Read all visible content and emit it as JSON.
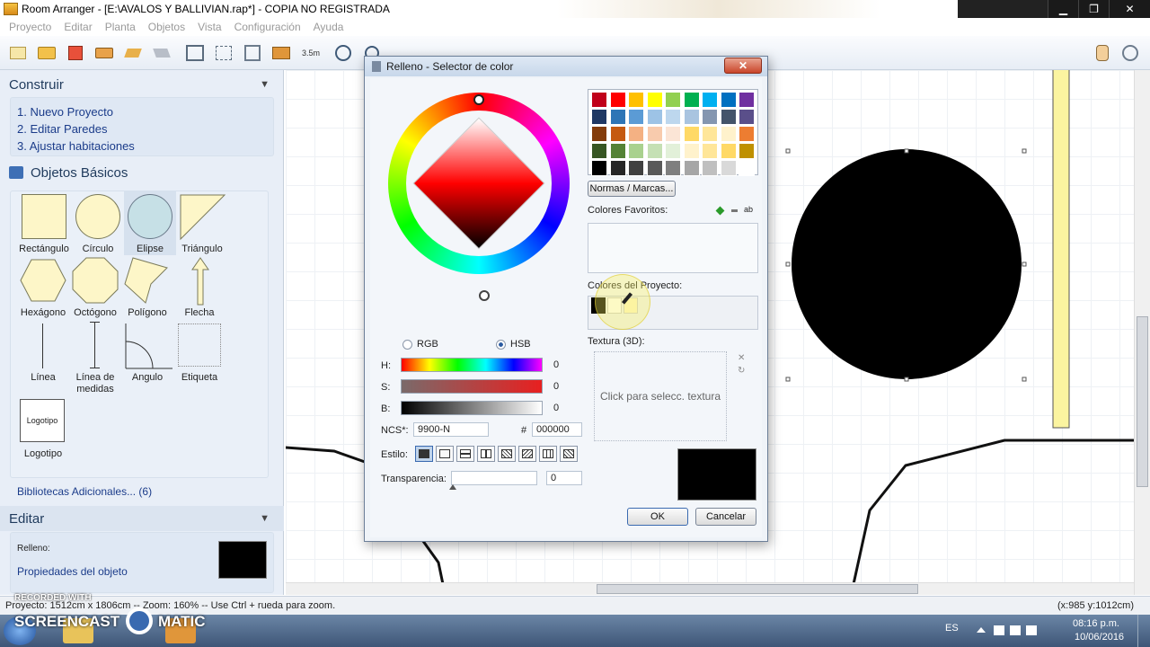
{
  "window": {
    "title": "Room Arranger - [E:\\AVALOS Y BALLIVIAN.rap*] - COPIA NO REGISTRADA",
    "minimize": "▁",
    "maximize": "❐",
    "close": "✕"
  },
  "menu": [
    "Proyecto",
    "Editar",
    "Planta",
    "Objetos",
    "Vista",
    "Configuración",
    "Ayuda"
  ],
  "toolbar": {
    "scale_label": "3.5m"
  },
  "construir": {
    "header": "Construir",
    "steps": [
      "1. Nuevo Proyecto",
      "2. Editar Paredes",
      "3. Ajustar habitaciones"
    ]
  },
  "objetos_basicos": {
    "header": "Objetos Básicos",
    "shapes": [
      "Rectángulo",
      "Círculo",
      "Elipse",
      "Triángulo",
      "Hexágono",
      "Octógono",
      "Polígono",
      "Flecha",
      "Línea",
      "Línea de medidas",
      "Angulo",
      "Etiqueta",
      "Logotipo"
    ],
    "logotipo_preview": "Logotipo",
    "bibliotecas": "Bibliotecas Adicionales... (6)"
  },
  "editar": {
    "header": "Editar",
    "relleno_label": "Relleno:",
    "propiedades": "Propiedades del objeto",
    "fill_color": "#000000"
  },
  "status": {
    "text": "Proyecto: 1512cm x 1806cm -- Zoom: 160% -- Use Ctrl + rueda para zoom.",
    "coords": "(x:985 y:1012cm)"
  },
  "dialog": {
    "title": "Relleno - Selector de color",
    "close": "✕",
    "rgb_label": "RGB",
    "hsb_label": "HSB",
    "mode_selected": "HSB",
    "h_label": "H:",
    "s_label": "S:",
    "b_label": "B:",
    "h_value": "0",
    "s_value": "0",
    "b_value": "0",
    "ncs_label": "NCS*:",
    "ncs_value": "9900-N",
    "hex_label": "#",
    "hex_value": "000000",
    "estilo_label": "Estilo:",
    "transparencia_label": "Transparencia:",
    "transparencia_value": "0",
    "normas_button": "Normas / Marcas...",
    "favoritos_label": "Colores Favoritos:",
    "favoritos_ab": "ab",
    "proyecto_label": "Colores del Proyecto:",
    "textura_label": "Textura (3D):",
    "textura_placeholder": "Click para selecc. textura",
    "ok": "OK",
    "cancel": "Cancelar",
    "selected_color": "#000000",
    "palette": [
      "#c0001a",
      "#ff0000",
      "#ffc000",
      "#ffff00",
      "#92d050",
      "#00b050",
      "#00b0f0",
      "#0070c0",
      "#7030a0",
      "#1f3864",
      "#2e75b6",
      "#5b9bd5",
      "#9dc3e6",
      "#bdd7ee",
      "#a9c4e0",
      "#8496b0",
      "#44546a",
      "#5a4f8a",
      "#833c0b",
      "#c55a11",
      "#f4b183",
      "#f8cbad",
      "#fbe5d6",
      "#ffd966",
      "#ffe699",
      "#fff2cc",
      "#ed7d31",
      "#375623",
      "#548235",
      "#a9d18e",
      "#c5e0b4",
      "#e2f0d9",
      "#fff2cc",
      "#ffe699",
      "#ffd966",
      "#bf9000",
      "#000000",
      "#262626",
      "#404040",
      "#595959",
      "#7f7f7f",
      "#a6a6a6",
      "#bfbfbf",
      "#d9d9d9",
      "#ffffff"
    ]
  },
  "taskbar": {
    "lang": "ES",
    "time": "08:16 p.m.",
    "date": "10/06/2016",
    "watermark_top": "RECORDED WITH",
    "watermark_left": "SCREENCAST",
    "watermark_right": "MATIC"
  }
}
